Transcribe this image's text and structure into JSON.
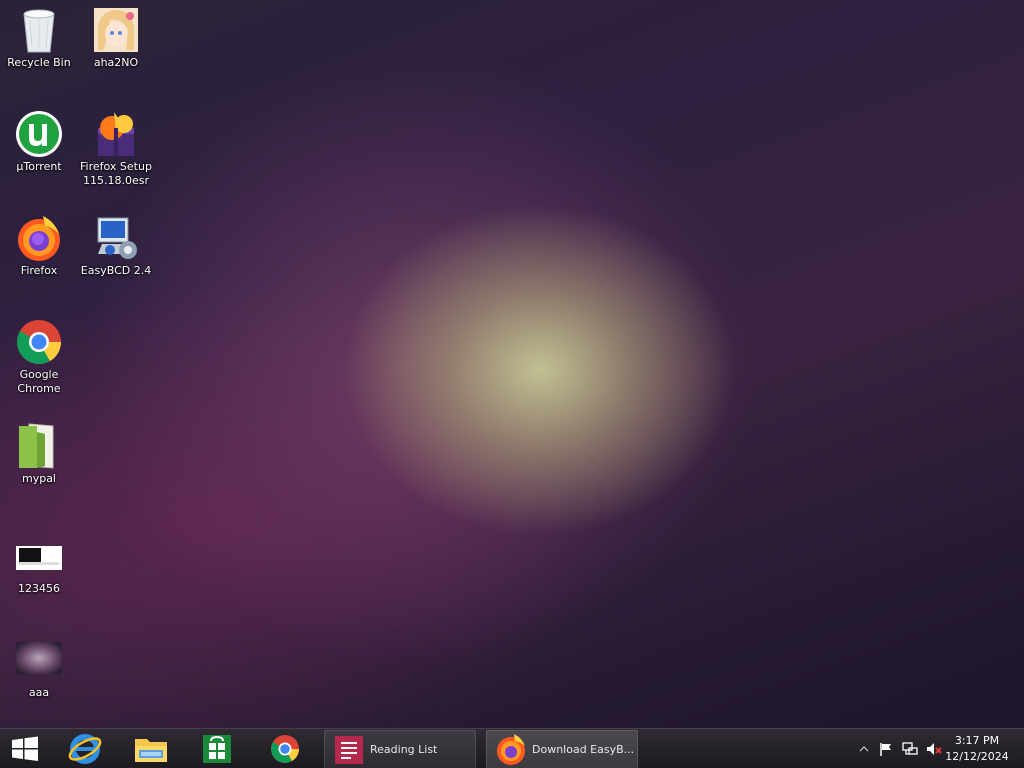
{
  "desktop": {
    "icons": [
      {
        "label": "Recycle Bin",
        "icon": "recycle-bin-icon"
      },
      {
        "label": "aha2NO",
        "icon": "anime-image-icon"
      },
      {
        "label": "µTorrent",
        "icon": "utorrent-icon"
      },
      {
        "label": "Firefox Setup\n115.18.0esr",
        "icon": "firefox-installer-icon"
      },
      {
        "label": "Firefox",
        "icon": "firefox-icon"
      },
      {
        "label": "EasyBCD 2.4",
        "icon": "easybcd-icon"
      },
      {
        "label": "Google\nChrome",
        "icon": "chrome-icon"
      },
      {
        "label": "mypal",
        "icon": "folder-icon"
      },
      {
        "label": "123456",
        "icon": "image-file-icon"
      },
      {
        "label": "aaa",
        "icon": "image-file-icon"
      }
    ]
  },
  "taskbar": {
    "pinned": [
      "windows-start-icon",
      "internet-explorer-icon",
      "file-explorer-icon",
      "store-icon",
      "chrome-icon"
    ],
    "tasks": [
      {
        "label": "Reading List",
        "icon": "reading-list-icon"
      },
      {
        "label": "Download EasyB...",
        "icon": "firefox-icon"
      }
    ],
    "tray": {
      "clock_time": "3:17 PM",
      "clock_date": "12/12/2024"
    }
  }
}
